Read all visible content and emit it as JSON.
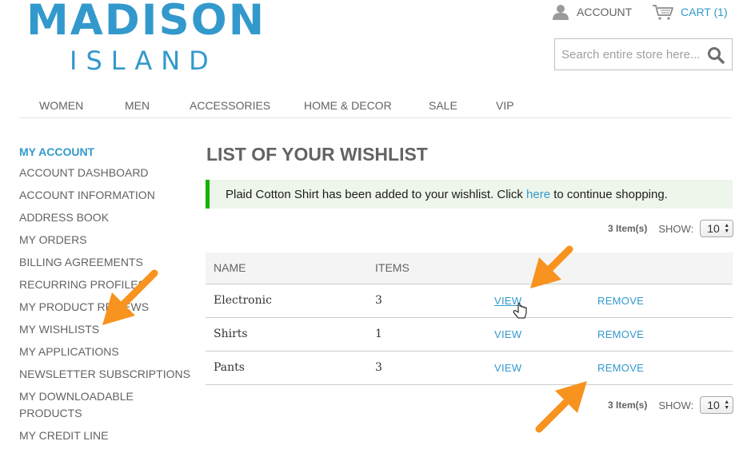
{
  "logo": {
    "main": "MADISON",
    "sub": "ISLAND"
  },
  "header": {
    "account_label": "ACCOUNT",
    "account_icon": "user-icon",
    "cart_label": "CART (1)",
    "cart_icon": "cart-icon",
    "search_placeholder": "Search entire store here...",
    "search_icon": "search-icon"
  },
  "nav": {
    "items": [
      {
        "label": "WOMEN"
      },
      {
        "label": "MEN"
      },
      {
        "label": "ACCESSORIES"
      },
      {
        "label": "HOME & DECOR"
      },
      {
        "label": "SALE"
      },
      {
        "label": "VIP"
      }
    ]
  },
  "sidebar": {
    "title": "MY ACCOUNT",
    "items": [
      {
        "label": "ACCOUNT DASHBOARD"
      },
      {
        "label": "ACCOUNT INFORMATION"
      },
      {
        "label": "ADDRESS BOOK"
      },
      {
        "label": "MY ORDERS"
      },
      {
        "label": "BILLING AGREEMENTS"
      },
      {
        "label": "RECURRING PROFILES"
      },
      {
        "label": "MY PRODUCT REVIEWS"
      },
      {
        "label": "MY WISHLISTS"
      },
      {
        "label": "MY APPLICATIONS"
      },
      {
        "label": "NEWSLETTER SUBSCRIPTIONS"
      },
      {
        "label": "MY DOWNLOADABLE PRODUCTS"
      },
      {
        "label": "MY CREDIT LINE"
      }
    ]
  },
  "main": {
    "title": "LIST OF YOUR WISHLIST",
    "message": {
      "before": "Plaid Cotton Shirt has been added to your wishlist. Click ",
      "link": "here",
      "after": " to continue shopping."
    },
    "toolbar": {
      "count": "3 Item(s)",
      "show_label": "SHOW:",
      "show_value": "10"
    },
    "table": {
      "headers": {
        "name": "NAME",
        "items": "ITEMS"
      },
      "rows": [
        {
          "name": "Electronic",
          "items": "3",
          "view": "VIEW",
          "remove": "REMOVE"
        },
        {
          "name": "Shirts",
          "items": "1",
          "view": "VIEW",
          "remove": "REMOVE"
        },
        {
          "name": "Pants",
          "items": "3",
          "view": "VIEW",
          "remove": "REMOVE"
        }
      ]
    }
  },
  "colors": {
    "brand": "#3399cc",
    "text": "#636363",
    "success_border": "#11b400",
    "success_bg": "#eef5ea",
    "annotation_arrow": "#f7931e"
  }
}
